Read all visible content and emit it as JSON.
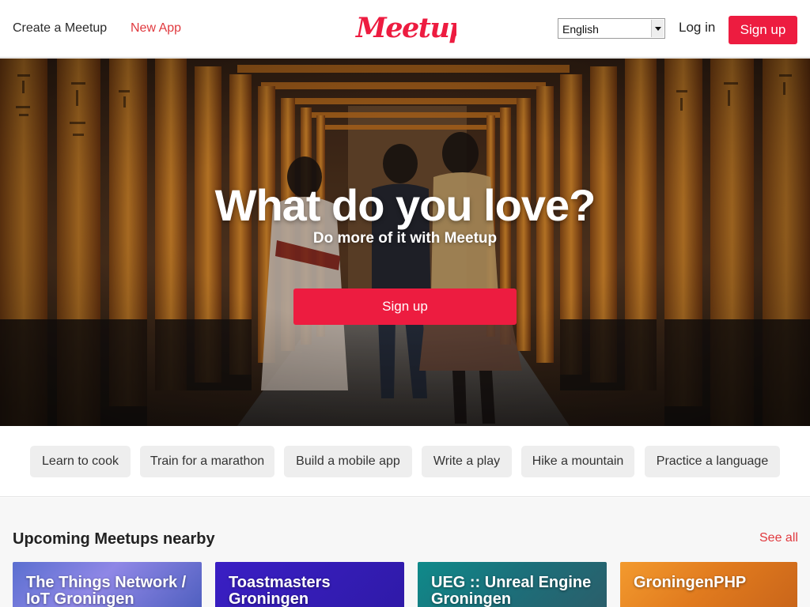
{
  "header": {
    "create_meetup": "Create a Meetup",
    "new_app": "New App",
    "logo_text": "Meetup",
    "language": {
      "selected": "English"
    },
    "login": "Log in",
    "signup": "Sign up"
  },
  "hero": {
    "title": "What do you love?",
    "subtitle": "Do more of it with Meetup",
    "signup": "Sign up"
  },
  "categories": [
    "Learn to cook",
    "Train for a marathon",
    "Build a mobile app",
    "Write a play",
    "Hike a mountain",
    "Practice a language"
  ],
  "upcoming": {
    "title": "Upcoming Meetups nearby",
    "see_all": "See all",
    "cards": [
      {
        "title": "The Things Network / IoT Groningen"
      },
      {
        "title": "Toastmasters Groningen"
      },
      {
        "title": "UEG :: Unreal Engine Groningen"
      },
      {
        "title": "GroningenPHP"
      }
    ]
  },
  "colors": {
    "brand": "#ed1c40",
    "link_red": "#e0393e",
    "pill_bg": "#eeeeee"
  }
}
